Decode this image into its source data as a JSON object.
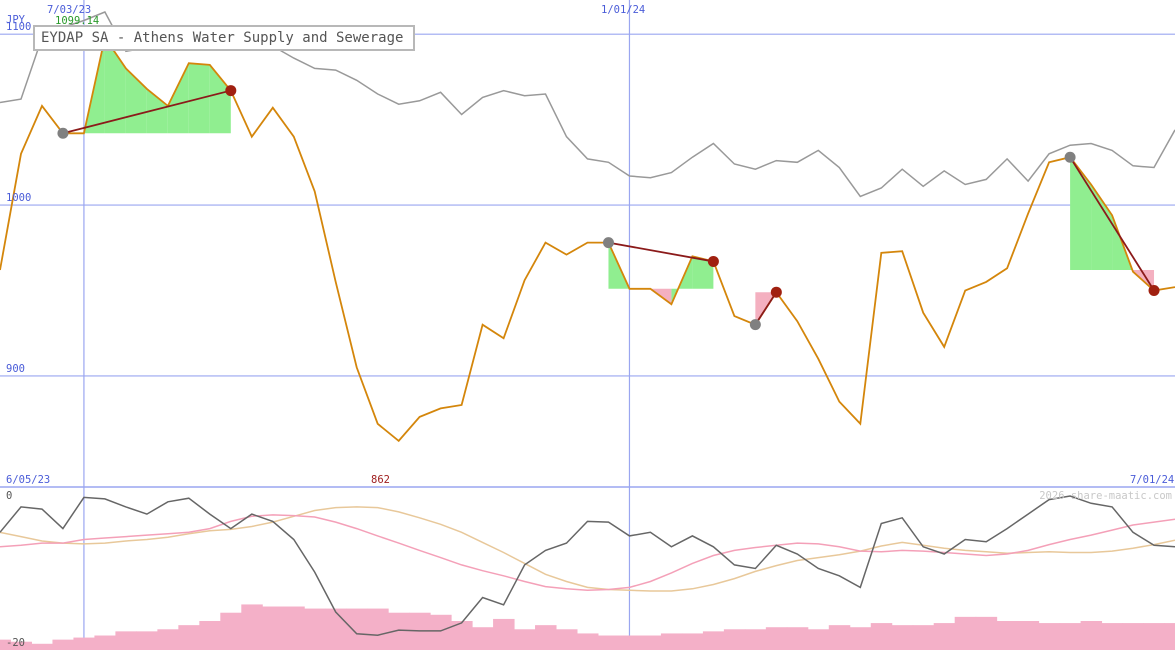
{
  "title": "EYDAP SA - Athens Water Supply and Sewerage",
  "currency": "JPY",
  "watermark": "2026 share-maatic.com",
  "cursor": {
    "date": "7/03/23",
    "value": "1099.14"
  },
  "lower_dates": {
    "left": "6/05/23",
    "right": "7/01/24"
  },
  "lower_low_label": "862",
  "colors": {
    "price": "#d4860b",
    "compare": "#999999",
    "grid": "#9aa6f0",
    "gain": "#90ee90",
    "loss": "#f4b0c0",
    "oscillator": "#666666",
    "ma_fast": "#f4a0b8",
    "ma_slow": "#e8c89a",
    "volume": "#f4b0c8"
  },
  "chart_data": {
    "type": "line",
    "x": [
      "6/05/23",
      "6/12/23",
      "6/19/23",
      "6/26/23",
      "7/03/23",
      "7/10/23",
      "7/17/23",
      "7/24/23",
      "7/31/23",
      "8/07/23",
      "8/14/23",
      "8/21/23",
      "8/28/23",
      "9/04/23",
      "9/11/23",
      "9/18/23",
      "9/25/23",
      "10/02/23",
      "10/09/23",
      "10/16/23",
      "10/23/23",
      "10/30/23",
      "11/06/23",
      "11/13/23",
      "11/20/23",
      "11/27/23",
      "12/04/23",
      "12/11/23",
      "12/18/23",
      "12/25/23",
      "1/01/24",
      "1/08/24",
      "1/15/24",
      "1/22/24",
      "1/29/24",
      "2/05/24",
      "2/12/24",
      "2/19/24",
      "2/26/24",
      "3/04/24",
      "3/11/24",
      "3/18/24",
      "3/25/24",
      "4/01/24",
      "4/08/24",
      "4/15/24",
      "4/22/24",
      "4/29/24",
      "5/06/24",
      "5/13/24",
      "5/20/24",
      "5/27/24",
      "6/03/24",
      "6/10/24",
      "6/17/24",
      "6/24/24",
      "7/01/24"
    ],
    "series": [
      {
        "name": "",
        "values": [
          962,
          1030,
          1058,
          1042,
          1042,
          1098,
          1080,
          1068,
          1058,
          1083,
          1082,
          1067,
          1040,
          1057,
          1040,
          1008,
          955,
          905,
          872,
          862,
          876,
          881,
          883,
          930,
          922,
          956,
          978,
          971,
          978,
          978,
          951,
          951,
          942,
          970,
          967,
          935,
          930,
          949,
          932,
          910,
          885,
          872,
          972,
          973,
          937,
          917,
          950,
          955,
          963,
          995,
          1025,
          1028,
          1012,
          994,
          961,
          950,
          952
        ]
      },
      {
        "name": "",
        "values": [
          1060,
          1062,
          1098,
          1104,
          1108,
          1113,
          1090,
          1092,
          1095,
          1092,
          1092,
          1101,
          1100,
          1093,
          1086,
          1080,
          1079,
          1073,
          1065,
          1059,
          1061,
          1066,
          1053,
          1063,
          1067,
          1064,
          1065,
          1040,
          1027,
          1025,
          1017,
          1016,
          1019,
          1028,
          1036,
          1024,
          1021,
          1026,
          1025,
          1032,
          1022,
          1005,
          1010,
          1021,
          1011,
          1020,
          1012,
          1015,
          1027,
          1014,
          1030,
          1035,
          1036,
          1032,
          1023,
          1022,
          1044
        ]
      }
    ],
    "ylim": [
      835,
      1120
    ],
    "yticks": [
      900,
      1000,
      1100
    ],
    "grid": true,
    "gains": [
      {
        "start": 3,
        "end": 11,
        "base": 1042
      },
      {
        "start": 29,
        "end": 34,
        "base": 951
      },
      {
        "start": 36,
        "end": 37,
        "base": 949
      },
      {
        "start": 51,
        "end": 55,
        "base": 962
      }
    ],
    "lows": [
      {
        "start": 3,
        "end": 11
      },
      {
        "start": 29,
        "end": 34
      },
      {
        "start": 36,
        "end": 37
      },
      {
        "start": 51,
        "end": 55
      }
    ],
    "lower": {
      "ylim": [
        -20,
        0
      ],
      "yticks": [
        0,
        -20
      ],
      "oscillator": [
        -5,
        -1.5,
        -1.8,
        -4.5,
        -0.2,
        -0.4,
        -1.5,
        -2.5,
        -0.8,
        -0.3,
        -2.5,
        -4.5,
        -2.5,
        -3.5,
        -6,
        -10.5,
        -16,
        -19,
        -19.2,
        -18.5,
        -18.6,
        -18.6,
        -17.5,
        -14,
        -15,
        -9.5,
        -7.5,
        -6.5,
        -3.5,
        -3.6,
        -5.5,
        -5,
        -7,
        -5.5,
        -7,
        -9.5,
        -10,
        -6.8,
        -8,
        -10,
        -11,
        -12.6,
        -3.8,
        -3,
        -7,
        -8,
        -6,
        -6.3,
        -4.5,
        -2.5,
        -0.5,
        0,
        -1,
        -1.5,
        -5,
        -6.8,
        -7
      ],
      "ma_fast": [
        -7,
        -6.8,
        -6.5,
        -6.5,
        -6,
        -5.8,
        -5.6,
        -5.4,
        -5.2,
        -5,
        -4.5,
        -3.5,
        -2.8,
        -2.6,
        -2.7,
        -2.9,
        -3.6,
        -4.5,
        -5.5,
        -6.5,
        -7.5,
        -8.5,
        -9.5,
        -10.3,
        -11,
        -11.8,
        -12.5,
        -12.8,
        -13,
        -12.9,
        -12.6,
        -11.8,
        -10.6,
        -9.3,
        -8.2,
        -7.5,
        -7.1,
        -6.8,
        -6.5,
        -6.6,
        -7,
        -7.6,
        -7.7,
        -7.5,
        -7.6,
        -7.8,
        -8,
        -8.2,
        -8,
        -7.5,
        -6.7,
        -6,
        -5.4,
        -4.7,
        -4,
        -3.6,
        -3.2
      ],
      "ma_slow": [
        -5,
        -5.6,
        -6.2,
        -6.5,
        -6.6,
        -6.5,
        -6.2,
        -6,
        -5.7,
        -5.2,
        -4.8,
        -4.6,
        -4.2,
        -3.6,
        -2.8,
        -2,
        -1.6,
        -1.5,
        -1.6,
        -2.2,
        -3,
        -3.9,
        -5,
        -6.4,
        -7.8,
        -9.3,
        -10.8,
        -11.8,
        -12.6,
        -12.9,
        -13,
        -13.1,
        -13.1,
        -12.8,
        -12.2,
        -11.4,
        -10.4,
        -9.6,
        -8.9,
        -8.5,
        -8.1,
        -7.6,
        -6.9,
        -6.4,
        -6.8,
        -7.2,
        -7.5,
        -7.7,
        -7.9,
        -7.8,
        -7.7,
        -7.8,
        -7.8,
        -7.6,
        -7.2,
        -6.7,
        -6.1
      ],
      "volume": [
        5,
        4,
        3,
        5,
        6,
        7,
        9,
        9,
        10,
        12,
        14,
        18,
        22,
        21,
        21,
        20,
        20,
        20,
        20,
        18,
        18,
        17,
        14,
        11,
        15,
        10,
        12,
        10,
        8,
        7,
        7,
        7,
        8,
        8,
        9,
        10,
        10,
        11,
        11,
        10,
        12,
        11,
        13,
        12,
        12,
        13,
        16,
        16,
        14,
        14,
        13,
        13,
        14,
        13,
        13,
        13,
        13
      ]
    }
  }
}
